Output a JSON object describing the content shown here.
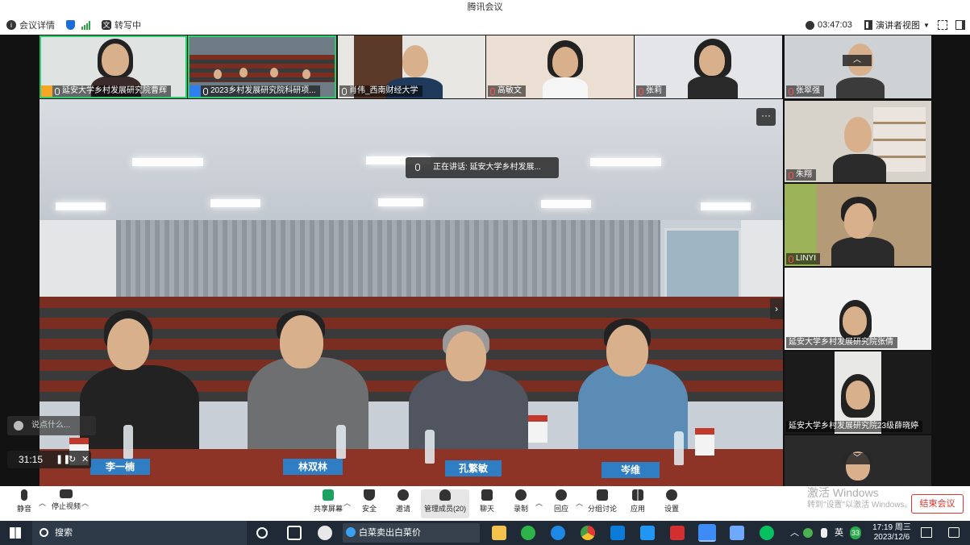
{
  "window": {
    "title": "腾讯会议"
  },
  "topbar": {
    "meeting_info": "会议详情",
    "transcribing": "转写中",
    "duration": "03:47:03",
    "view_mode": "演讲者视图"
  },
  "top_strip": [
    {
      "name": "延安大学乡村发展研究院曹辉",
      "badge": "host",
      "mic": "on"
    },
    {
      "name": "2023乡村发展研究院科研项...",
      "badge": "cohost",
      "mic": "on"
    },
    {
      "name": "肖伟_西南财经大学",
      "badge": "",
      "mic": "on"
    },
    {
      "name": "高敏文",
      "badge": "",
      "mic": "muted"
    },
    {
      "name": "张莉",
      "badge": "",
      "mic": "muted"
    }
  ],
  "side_strip": [
    {
      "name": "张翠强",
      "mic": "muted"
    },
    {
      "name": "朱翔",
      "mic": "muted"
    },
    {
      "name": "LINYI",
      "mic": "muted"
    },
    {
      "name": "延安大学乡村发展研究院张倩",
      "mic": ""
    },
    {
      "name": "延安大学乡村发展研究院23级薛晓婷",
      "mic": ""
    }
  ],
  "main_video": {
    "speaking_prefix": "正在讲话:",
    "speaking_name": "延安大学乡村发展...",
    "more": "···",
    "nameplates": [
      "李一楠",
      "林双林",
      "孔繁敏",
      "岑维"
    ]
  },
  "overlays": {
    "chat_placeholder": "说点什么...",
    "recording_time": "31:15"
  },
  "toolbar": {
    "mute": "静音",
    "stop_video": "停止视频",
    "share_screen": "共享屏幕",
    "security": "安全",
    "invite": "邀请",
    "manage_members": "管理成员(20)",
    "chat": "聊天",
    "record": "录制",
    "react": "回应",
    "breakout": "分组讨论",
    "apps": "应用",
    "settings": "设置",
    "end_meeting": "结束会议"
  },
  "watermark": {
    "line1": "激活 Windows",
    "line2": "转到\"设置\"以激活 Windows。"
  },
  "taskbar": {
    "search_label": "搜索",
    "browser_search": "白菜卖出白菜价",
    "ime": "英",
    "tray_badge": "33",
    "time": "17:19 周三",
    "date": "2023/12/6"
  }
}
